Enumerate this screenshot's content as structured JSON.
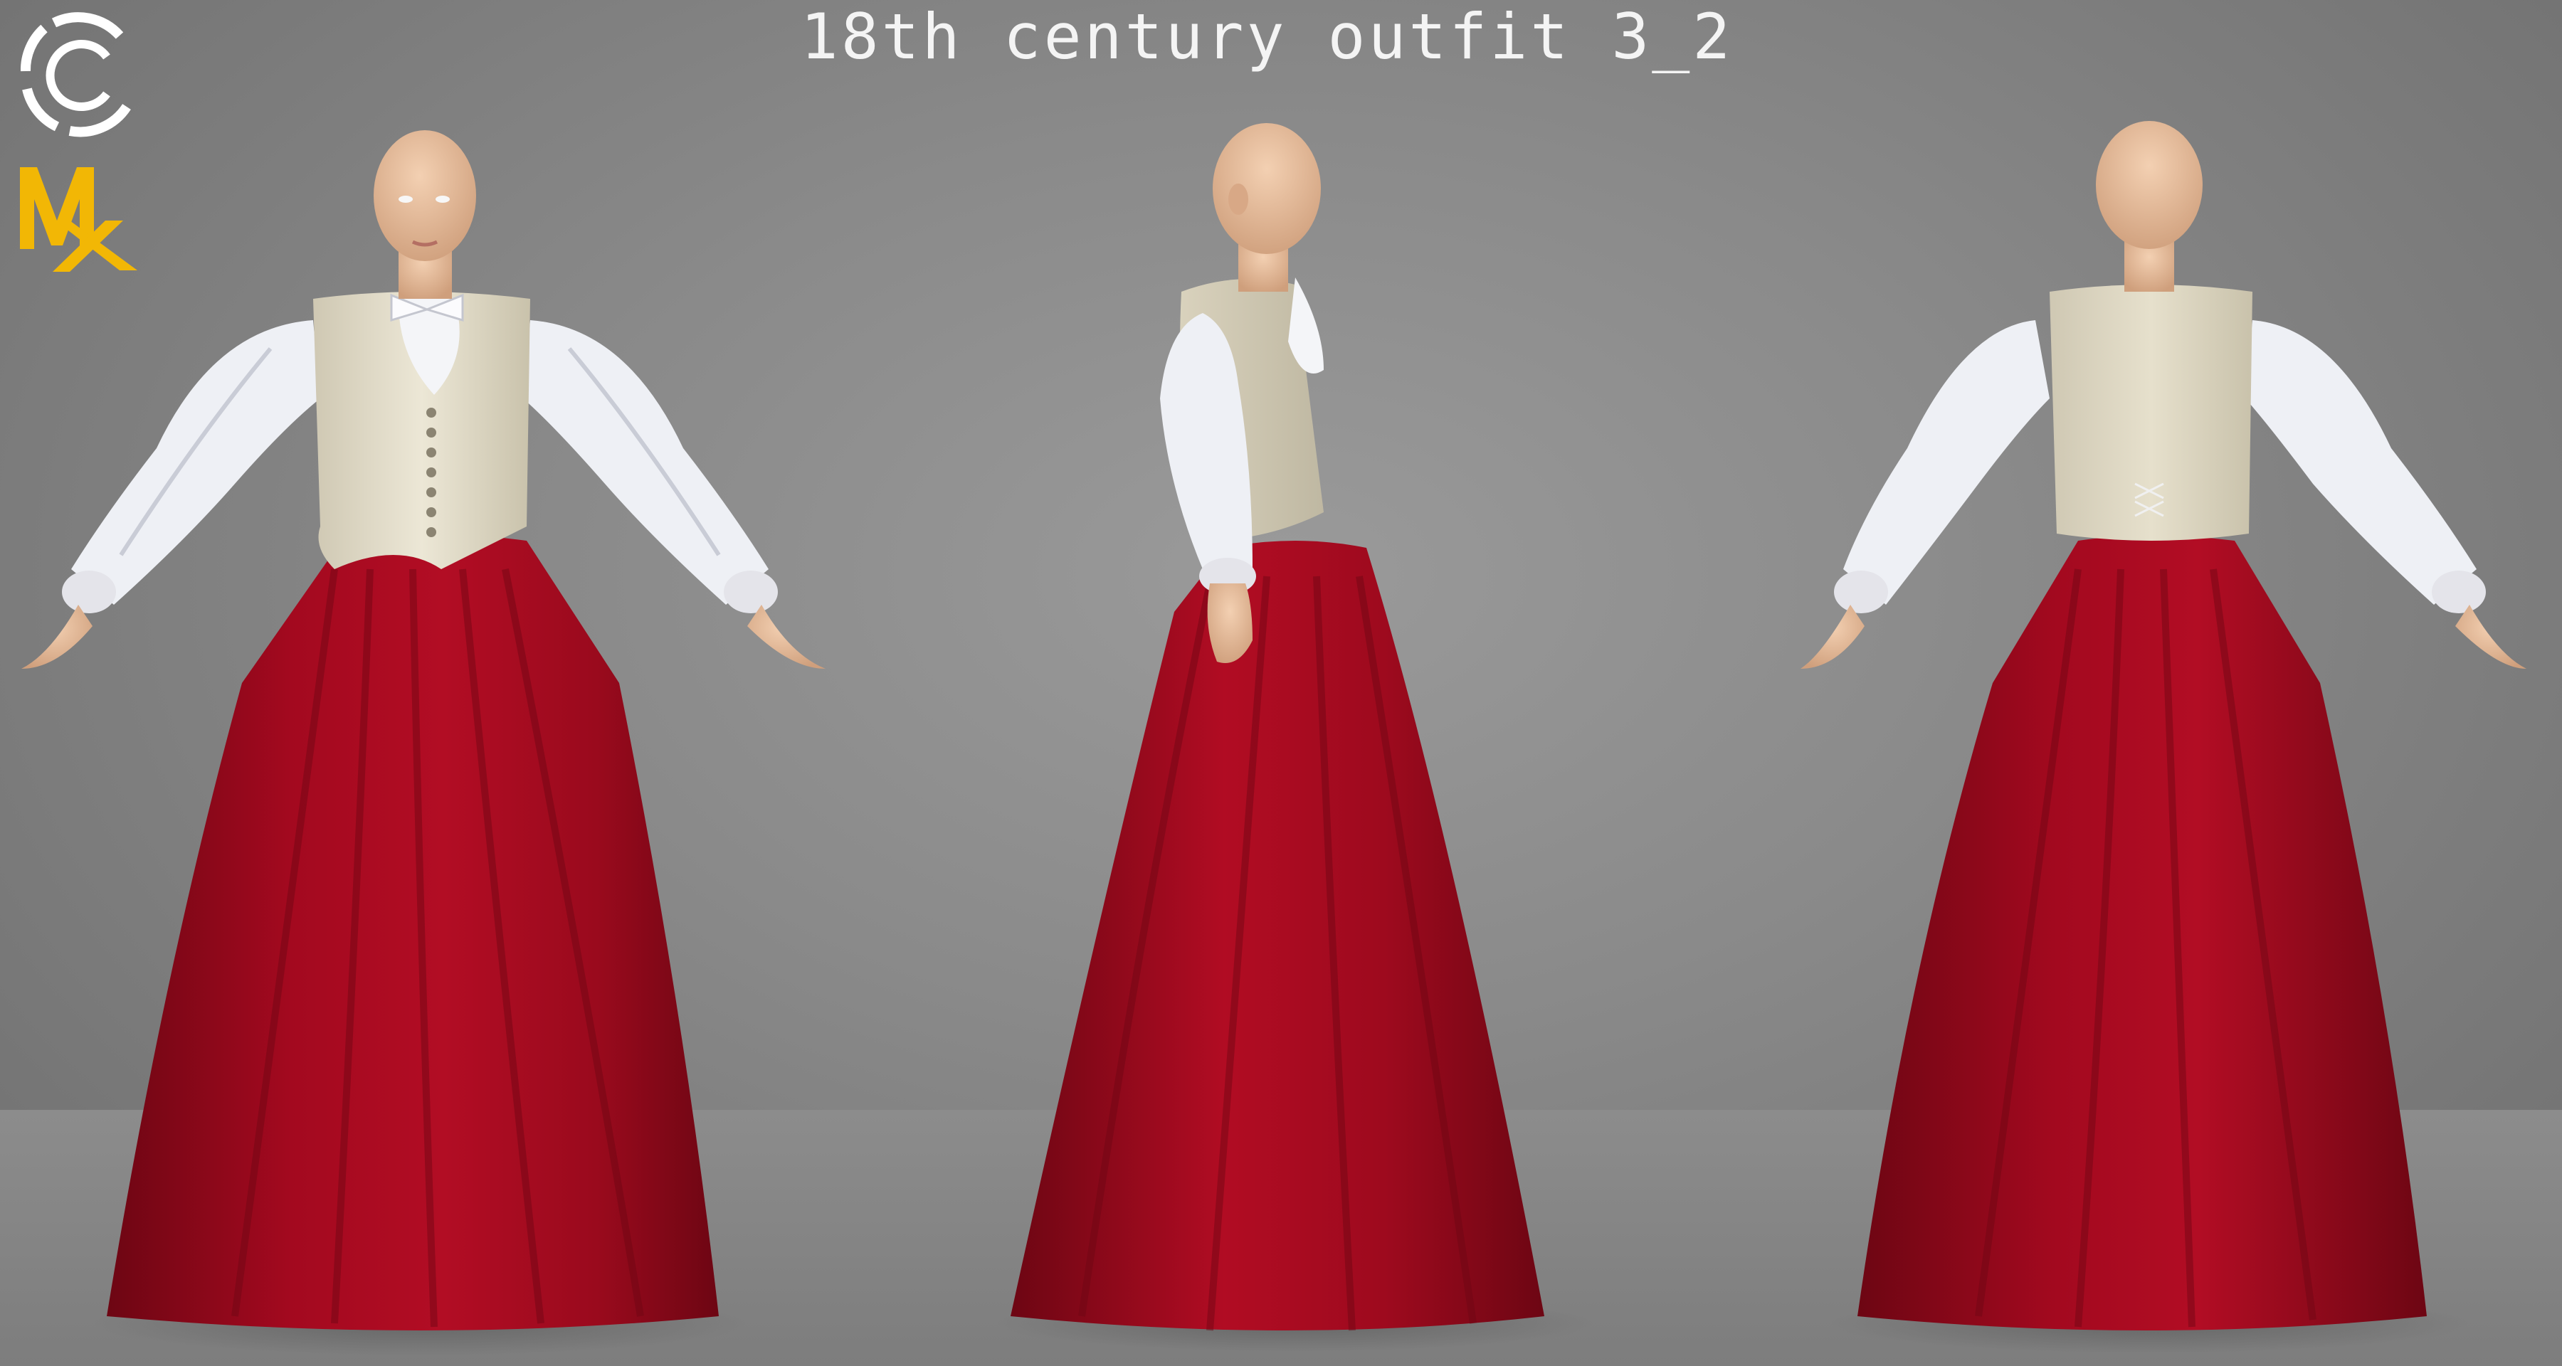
{
  "title": "18th century outfit 3_2",
  "logo": {
    "icon_name": "cm-logo-icon",
    "monogram_icon_name": "mx-monogram-icon",
    "accent_color": "#f2b705",
    "mark_color": "#ffffff"
  },
  "colors": {
    "background": "#8a8a8a",
    "skirt": "#a3091f",
    "skirt_shadow": "#6d0613",
    "vest": "#e8e2cf",
    "shirt": "#f1f2f6",
    "skin": "#e9bf9c"
  },
  "views": [
    {
      "id": "front",
      "icon_name": "figure-front-view"
    },
    {
      "id": "side",
      "icon_name": "figure-side-view"
    },
    {
      "id": "back",
      "icon_name": "figure-back-view"
    }
  ]
}
